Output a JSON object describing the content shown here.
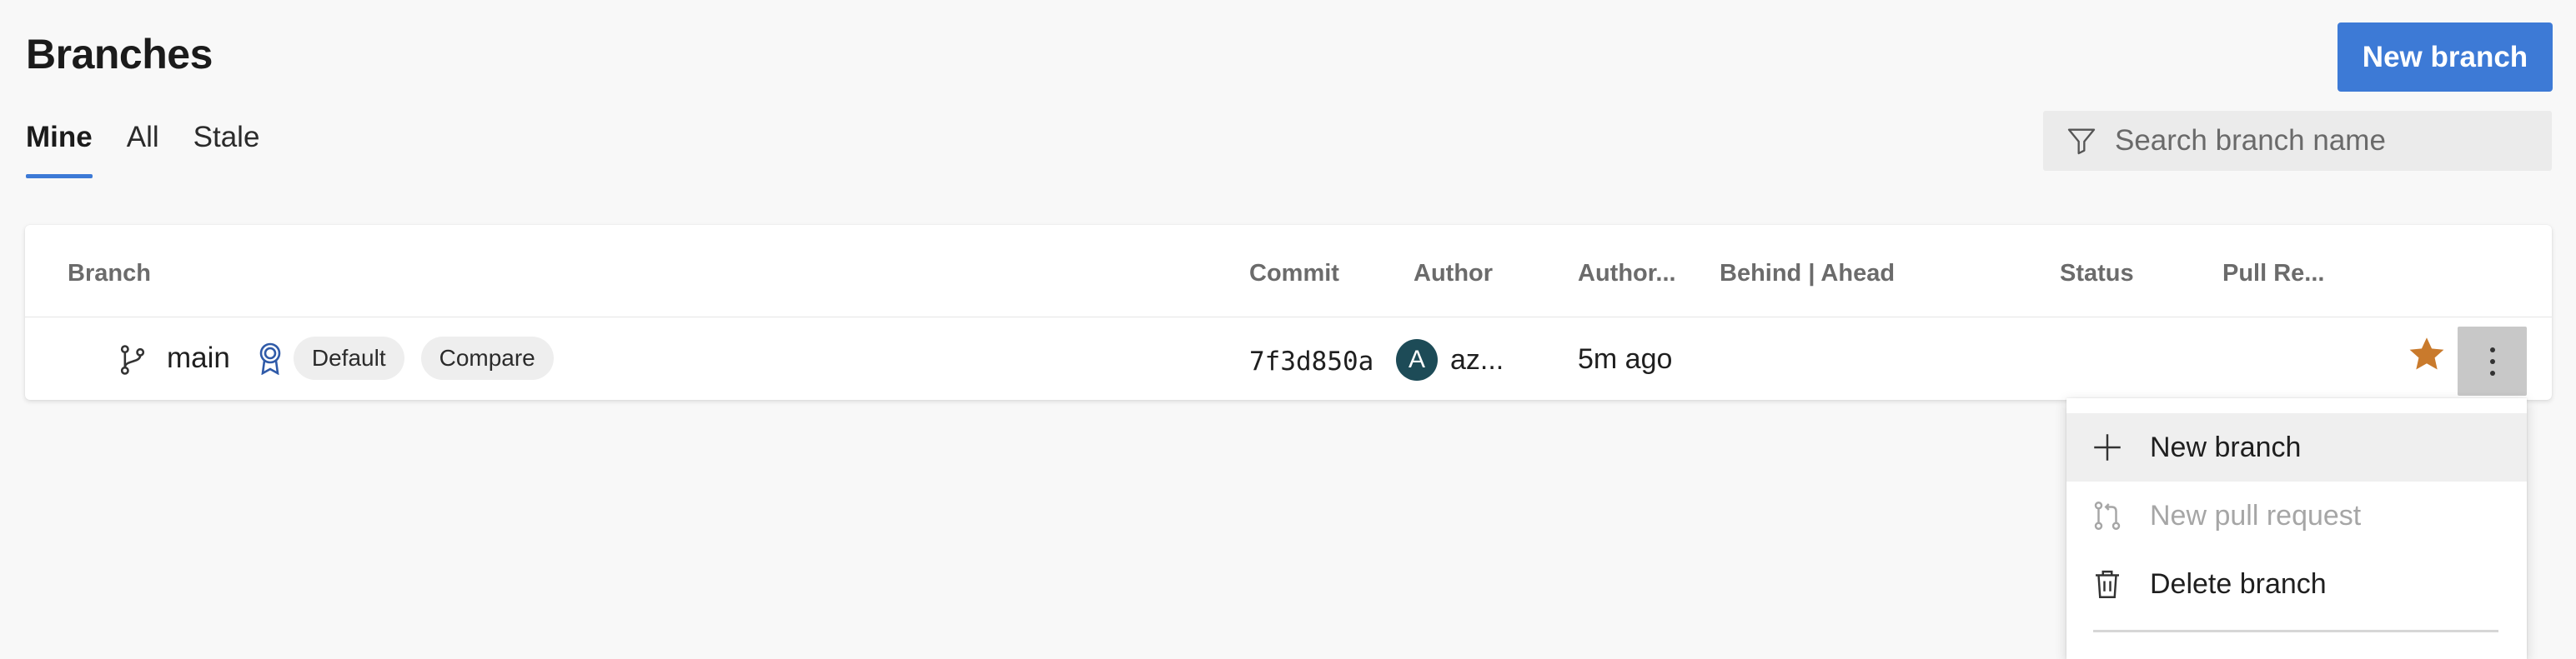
{
  "header": {
    "title": "Branches",
    "new_branch_label": "New branch"
  },
  "tabs": [
    {
      "label": "Mine",
      "active": true
    },
    {
      "label": "All",
      "active": false
    },
    {
      "label": "Stale",
      "active": false
    }
  ],
  "search": {
    "placeholder": "Search branch name",
    "value": ""
  },
  "table": {
    "columns": [
      "Branch",
      "Commit",
      "Author",
      "Author...",
      "Behind | Ahead",
      "Status",
      "Pull Re..."
    ],
    "rows": [
      {
        "branch": "main",
        "default_label": "Default",
        "compare_label": "Compare",
        "commit": "7f3d850a",
        "author_initial": "A",
        "author": "az...",
        "authored": "5m ago",
        "behind_ahead": "",
        "status": "",
        "pull_requests": "",
        "favorited": true
      }
    ]
  },
  "context_menu": {
    "items": [
      {
        "label": "New branch",
        "icon": "plus-icon",
        "disabled": false
      },
      {
        "label": "New pull request",
        "icon": "pull-request-icon",
        "disabled": true
      },
      {
        "label": "Delete branch",
        "icon": "trash-icon",
        "disabled": false
      }
    ]
  },
  "colors": {
    "accent": "#3d7ad6",
    "star": "#c97a2c",
    "avatar": "#1d4b57",
    "policy_badge": "#2f5aa8"
  }
}
